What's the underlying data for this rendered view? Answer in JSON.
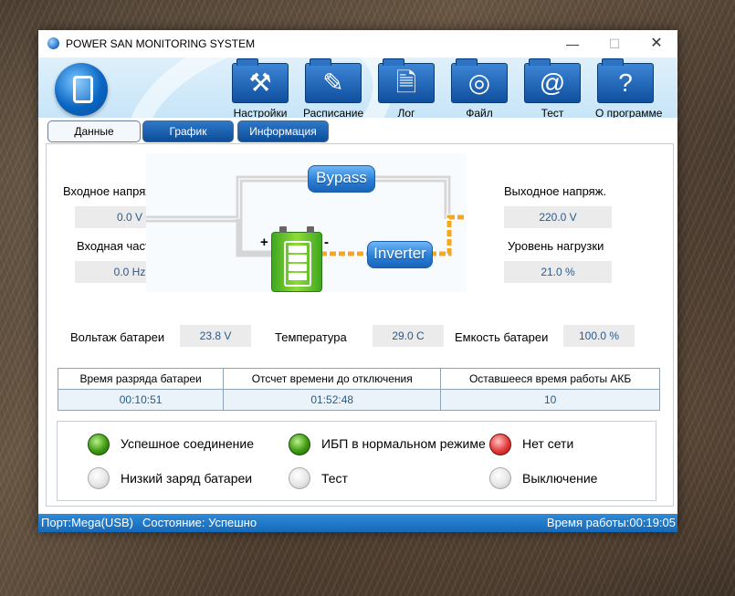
{
  "window": {
    "title": "POWER SAN MONITORING SYSTEM"
  },
  "toolbar": {
    "items": [
      {
        "label": "Настройки",
        "icon": "hammer-icon"
      },
      {
        "label": "Расписание",
        "icon": "schedule-icon"
      },
      {
        "label": "Лог",
        "icon": "log-document-icon"
      },
      {
        "label": "Файл",
        "icon": "file-disc-icon"
      },
      {
        "label": "Тест",
        "icon": "at-sign-icon"
      },
      {
        "label": "О программе",
        "icon": "question-mark-icon"
      }
    ]
  },
  "tabs": [
    {
      "label": "Данные",
      "active": true
    },
    {
      "label": "График",
      "active": false
    },
    {
      "label": "Информация",
      "active": false
    }
  ],
  "readings": {
    "input_voltage": {
      "label": "Входное напряжение",
      "value": "0.0 V"
    },
    "input_frequency": {
      "label": "Входная частота",
      "value": "0.0 Hz"
    },
    "output_voltage": {
      "label": "Выходное напряж.",
      "value": "220.0 V"
    },
    "load_level": {
      "label": "Уровень нагрузки",
      "value": "21.0 %"
    },
    "battery_voltage": {
      "label": "Вольтаж батареи",
      "value": "23.8 V"
    },
    "temperature": {
      "label": "Температура",
      "value": "29.0 C"
    },
    "battery_capacity": {
      "label": "Емкость батареи",
      "value": "100.0 %"
    }
  },
  "diagram": {
    "bypass_label": "Bypass",
    "inverter_label": "Inverter",
    "plus": "+",
    "minus": "-"
  },
  "times_table": {
    "headers": [
      "Время разряда батареи",
      "Отсчет времени до отключения",
      "Оставшееся время работы АКБ"
    ],
    "values": [
      "00:10:51",
      "01:52:48",
      "10"
    ]
  },
  "indicators": [
    {
      "label": "Успешное соединение",
      "state": "green"
    },
    {
      "label": "ИБП в нормальном режиме",
      "state": "green"
    },
    {
      "label": "Нет сети",
      "state": "red"
    },
    {
      "label": "Низкий заряд батареи",
      "state": "off"
    },
    {
      "label": "Тест",
      "state": "off"
    },
    {
      "label": "Выключение",
      "state": "off"
    }
  ],
  "statusbar": {
    "port": "Порт:Mega(USB)",
    "state": "Состояние: Успешно",
    "uptime": "Время работы:00:19:05"
  },
  "colors": {
    "accent_blue": "#1569b8",
    "path_orange": "#f5a623",
    "battery_green": "#6cc82b"
  }
}
